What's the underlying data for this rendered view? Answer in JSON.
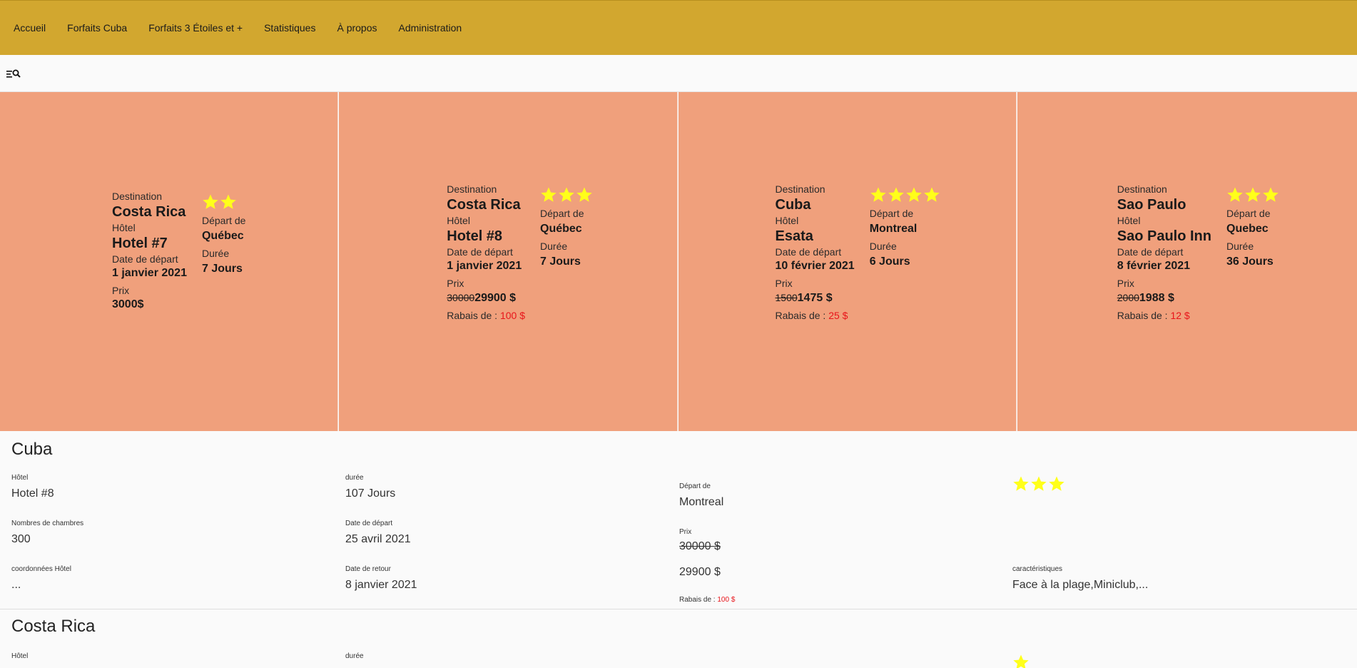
{
  "nav": {
    "items": [
      "Accueil",
      "Forfaits Cuba",
      "Forfaits 3 Étoiles et +",
      "Statistiques",
      "À propos",
      "Administration"
    ]
  },
  "toolbar": {
    "filter_icon": "filter-search-icon"
  },
  "labels": {
    "destination": "Destination",
    "hotel": "Hôtel",
    "departure_date": "Date de départ",
    "price": "Prix",
    "depart_from": "Départ de",
    "duration": "Durée",
    "discount": "Rabais de : "
  },
  "star_color": "#ffff1a",
  "cards": [
    {
      "destination": "Costa Rica",
      "hotel": "Hotel #7",
      "date": "1 janvier 2021",
      "price": "3000$",
      "old_price": "",
      "discount": "",
      "stars": 2,
      "from": "Québec",
      "duration": "7 Jours"
    },
    {
      "destination": "Costa Rica",
      "hotel": "Hotel #8",
      "date": "1 janvier 2021",
      "price": "29900 $",
      "old_price": "30000",
      "discount": "100 $",
      "stars": 3,
      "from": "Québec",
      "duration": "7 Jours"
    },
    {
      "destination": "Cuba",
      "hotel": "Esata",
      "date": "10 février 2021",
      "price": "1475 $",
      "old_price": "1500",
      "discount": "25 $",
      "stars": 4,
      "from": "Montreal",
      "duration": "6 Jours"
    },
    {
      "destination": "Sao Paulo",
      "hotel": "Sao Paulo Inn",
      "date": "8 février 2021",
      "price": "1988 $",
      "old_price": "2000",
      "discount": "12 $",
      "stars": 3,
      "from": "Quebec",
      "duration": "36 Jours"
    }
  ],
  "detail_labels": {
    "hotel": "Hôtel",
    "rooms": "Nombres de chambres",
    "coords": "coordonnées Hôtel",
    "duration": "durée",
    "departure_date": "Date de départ",
    "return_date": "Date de retour",
    "depart_from": "Départ de",
    "price": "Prix",
    "discount": "Rabais de : ",
    "features": "caractéristiques"
  },
  "details": [
    {
      "title": "Cuba",
      "hotel": "Hotel #8",
      "rooms": "300",
      "coords": "...",
      "duration": "107 Jours",
      "departure_date": "25 avril 2021",
      "return_date": "8 janvier 2021",
      "from": "Montreal",
      "old_price": "30000 $",
      "price": "29900 $",
      "discount": "100 $",
      "stars": 3,
      "features": "Face à la plage,Miniclub,..."
    },
    {
      "title": "Costa Rica",
      "stars": 1
    }
  ]
}
